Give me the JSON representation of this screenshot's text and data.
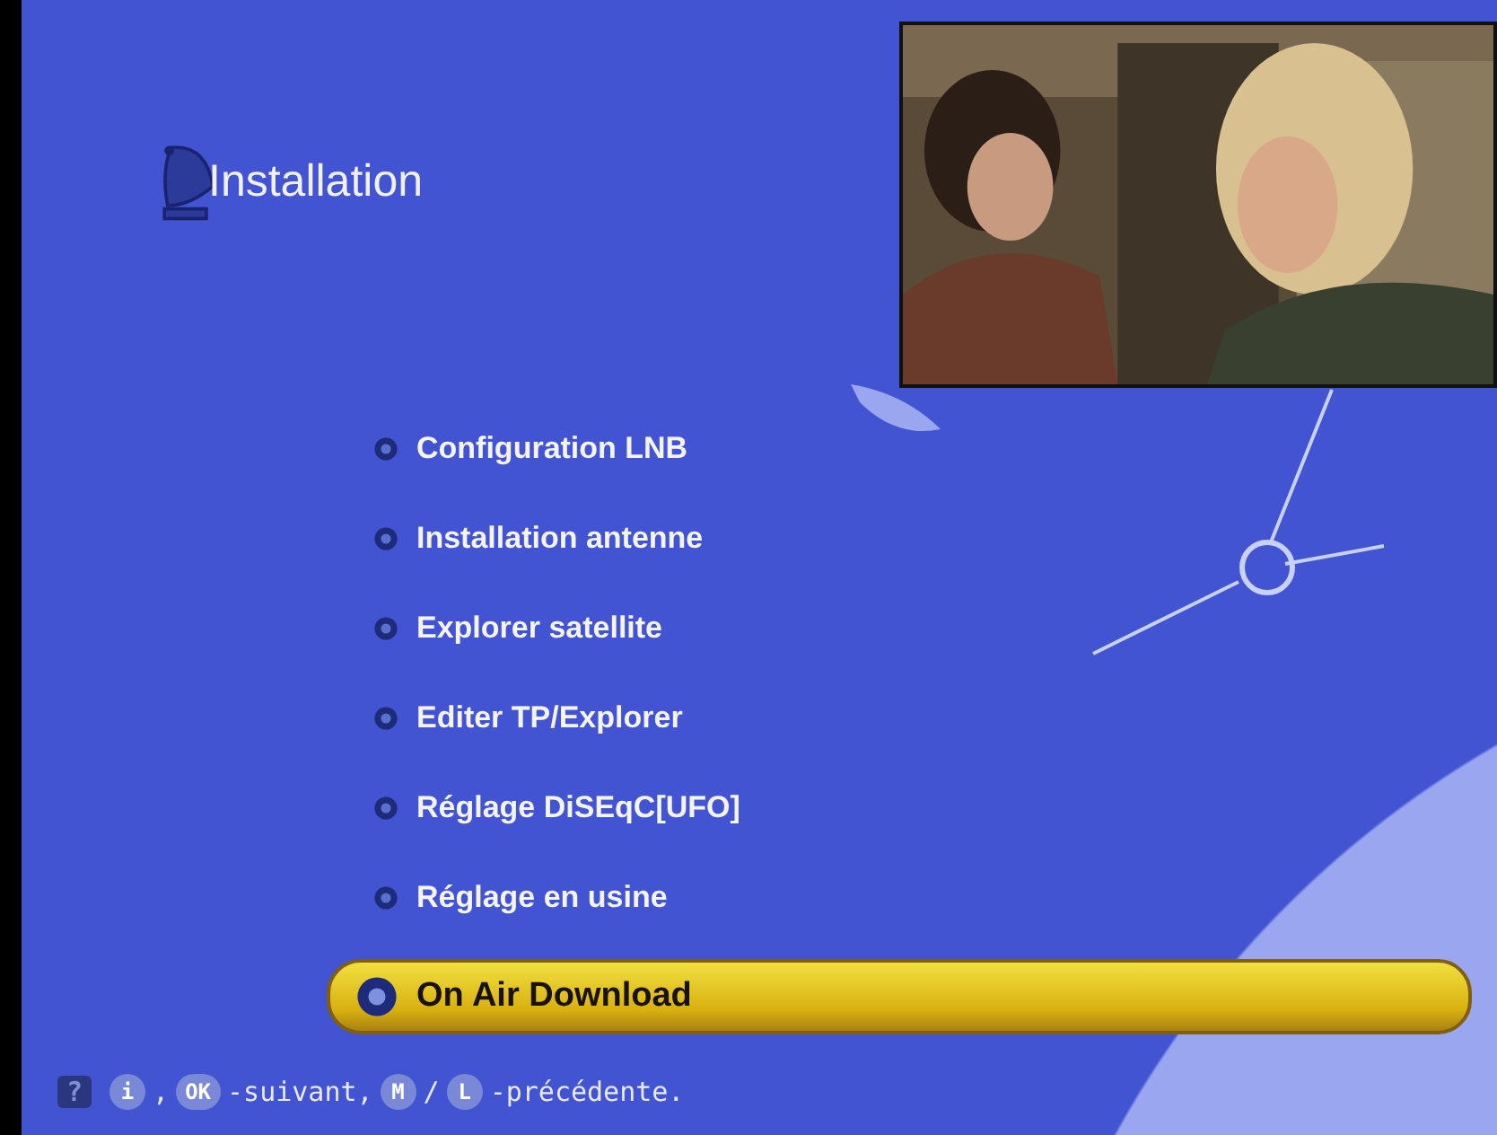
{
  "title": "Installation",
  "menu": [
    {
      "label": "Configuration LNB",
      "selected": false
    },
    {
      "label": "Installation antenne",
      "selected": false
    },
    {
      "label": "Explorer satellite",
      "selected": false
    },
    {
      "label": "Editer TP/Explorer",
      "selected": false
    },
    {
      "label": "Réglage DiSEqC[UFO]",
      "selected": false
    },
    {
      "label": "Réglage en usine",
      "selected": false
    },
    {
      "label": "On Air Download",
      "selected": true
    }
  ],
  "help": [
    {
      "kind": "help-key",
      "text": "?"
    },
    {
      "kind": "key",
      "text": "i"
    },
    {
      "kind": "text",
      "text": ","
    },
    {
      "kind": "key",
      "text": "OK"
    },
    {
      "kind": "text",
      "text": "-suivant,"
    },
    {
      "kind": "key",
      "text": "M"
    },
    {
      "kind": "text",
      "text": "/"
    },
    {
      "kind": "key",
      "text": "L"
    },
    {
      "kind": "text",
      "text": "-précédente."
    }
  ]
}
